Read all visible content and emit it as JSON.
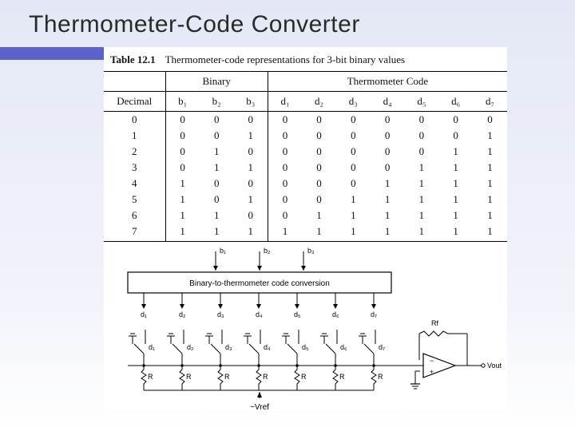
{
  "title": "Thermometer-Code Converter",
  "table": {
    "label_no": "Table 12.1",
    "label_text": "Thermometer-code representations for 3-bit binary values",
    "group_decimal": "Decimal",
    "group_binary": "Binary",
    "group_thermo": "Thermometer Code",
    "bin_headers": [
      "b₁",
      "b₂",
      "b₃"
    ],
    "therm_headers": [
      "d₁",
      "d₂",
      "d₃",
      "d₄",
      "d₅",
      "d₆",
      "d₇"
    ]
  },
  "chart_data": {
    "type": "table",
    "categories": [
      "Decimal",
      "b₁",
      "b₂",
      "b₃",
      "d₁",
      "d₂",
      "d₃",
      "d₄",
      "d₅",
      "d₆",
      "d₇"
    ],
    "rows": [
      [
        0,
        0,
        0,
        0,
        0,
        0,
        0,
        0,
        0,
        0,
        0
      ],
      [
        1,
        0,
        0,
        1,
        0,
        0,
        0,
        0,
        0,
        0,
        1
      ],
      [
        2,
        0,
        1,
        0,
        0,
        0,
        0,
        0,
        0,
        1,
        1
      ],
      [
        3,
        0,
        1,
        1,
        0,
        0,
        0,
        0,
        1,
        1,
        1
      ],
      [
        4,
        1,
        0,
        0,
        0,
        0,
        0,
        1,
        1,
        1,
        1
      ],
      [
        5,
        1,
        0,
        1,
        0,
        0,
        1,
        1,
        1,
        1,
        1
      ],
      [
        6,
        1,
        1,
        0,
        0,
        1,
        1,
        1,
        1,
        1,
        1
      ],
      [
        7,
        1,
        1,
        1,
        1,
        1,
        1,
        1,
        1,
        1,
        1
      ]
    ]
  },
  "diagram": {
    "block_label": "Binary-to-thermometer code conversion",
    "inputs": [
      "b₁",
      "b₂",
      "b₃"
    ],
    "outputs": [
      "d₁",
      "d₂",
      "d₃",
      "d₄",
      "d₅",
      "d₆",
      "d₇"
    ],
    "switch_nodes": [
      "d₁",
      "d₂",
      "d₃",
      "d₄",
      "d₅",
      "d₆",
      "d₇"
    ],
    "R_label": "R",
    "Rf_label": "Rf",
    "Vref_label": "−Vref",
    "Vout_label": "Vout"
  }
}
